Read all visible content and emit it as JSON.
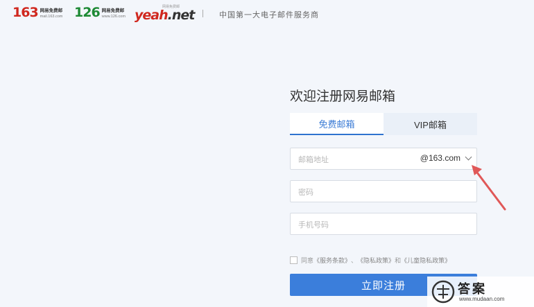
{
  "header": {
    "logos": [
      {
        "number": "163",
        "label_cn": "网易免费邮",
        "label_en": "mail.163.com"
      },
      {
        "number": "126",
        "label_cn": "网易免费邮",
        "label_en": "www.126.com"
      }
    ],
    "yeah": {
      "brand": "yeah",
      "suffix": ".net",
      "tag": "网易免费邮"
    },
    "slogan": "中国第一大电子邮件服务商"
  },
  "form": {
    "title": "欢迎注册网易邮箱",
    "tabs": [
      {
        "label": "免费邮箱",
        "active": true
      },
      {
        "label": "VIP邮箱",
        "active": false
      }
    ],
    "email": {
      "placeholder": "邮箱地址",
      "domain": "@163.com"
    },
    "password": {
      "placeholder": "密码"
    },
    "phone": {
      "placeholder": "手机号码"
    },
    "agreement": {
      "prefix": "同意",
      "terms": "《服务条款》",
      "sep": "、",
      "privacy": "《隐私政策》",
      "and": "和",
      "child_privacy": "《儿童隐私政策》",
      "checked": false
    },
    "submit_label": "立即注册"
  },
  "watermark": {
    "brand": "答案",
    "url": "www.mudaan.com"
  },
  "colors": {
    "primary": "#3b7edb",
    "brand_red": "#d0281f",
    "brand_green": "#1e8a35",
    "annotation": "#e05858"
  }
}
